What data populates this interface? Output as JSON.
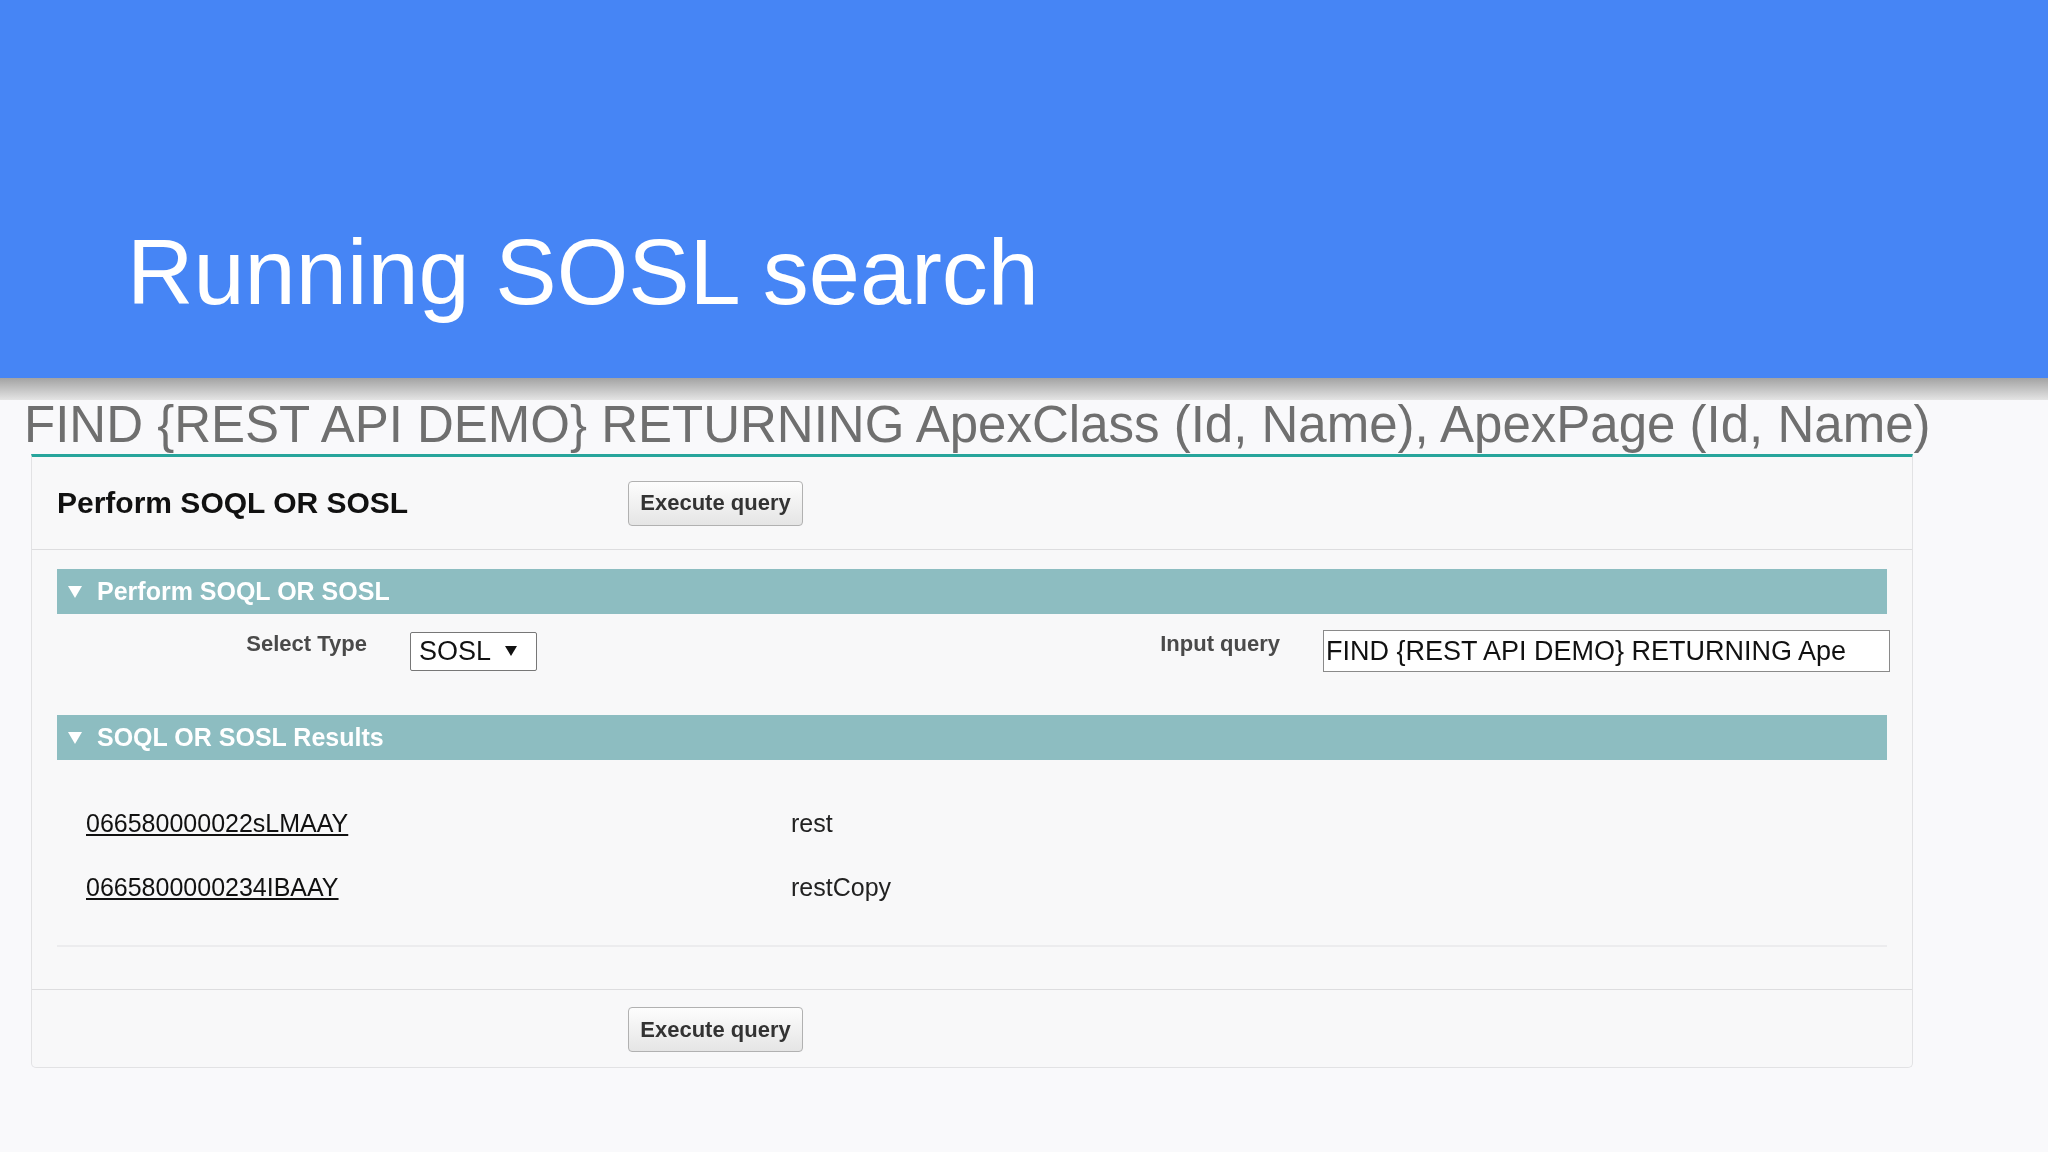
{
  "slide": {
    "title": "Running SOSL search"
  },
  "query_text": "FIND {REST API DEMO} RETURNING ApexClass (Id, Name), ApexPage (Id, Name)",
  "panel": {
    "title": "Perform SOQL OR SOSL",
    "top_button": "Execute query",
    "sections": [
      {
        "kind": "form",
        "title": "Perform SOQL OR SOSL",
        "expanded": true,
        "fields": [
          {
            "kind": "select",
            "label": "Select Type",
            "value": "SOSL"
          },
          {
            "kind": "text",
            "label": "Input query",
            "value": "FIND {REST API DEMO} RETURNING Ape"
          }
        ]
      },
      {
        "kind": "results",
        "title": "SOQL OR SOSL Results",
        "expanded": true,
        "rows": [
          {
            "link": "066580000022sLMAAY",
            "text": "rest"
          },
          {
            "link": "0665800000234IBAAY",
            "text": "restCopy"
          }
        ]
      }
    ],
    "bottom_button": "Execute query"
  }
}
